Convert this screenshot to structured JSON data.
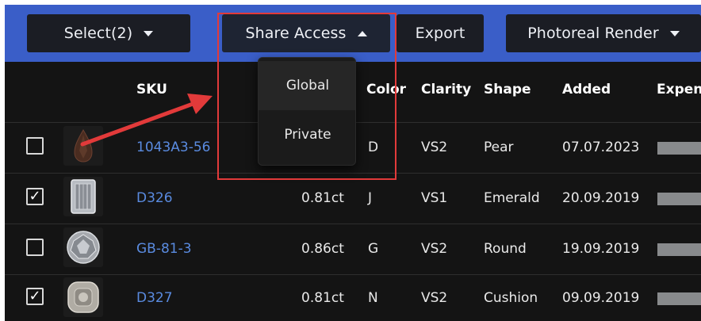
{
  "toolbar": {
    "select_label": "Select(2)",
    "share_label": "Share Access",
    "export_label": "Export",
    "render_label": "Photoreal Render"
  },
  "share_menu": {
    "items": [
      "Global",
      "Private"
    ]
  },
  "table": {
    "headers": {
      "sku": "SKU",
      "color": "Color",
      "clarity": "Clarity",
      "shape": "Shape",
      "added": "Added",
      "expense": "Expen"
    },
    "rows": [
      {
        "checked": false,
        "sku": "1043A3-56",
        "carat": "",
        "color": "D",
        "clarity": "VS2",
        "shape": "Pear",
        "added": "07.07.2023",
        "thumb": "pear-diamond"
      },
      {
        "checked": true,
        "sku": "D326",
        "carat": "0.81ct",
        "color": "J",
        "clarity": "VS1",
        "shape": "Emerald",
        "added": "20.09.2019",
        "thumb": "emerald-diamond"
      },
      {
        "checked": false,
        "sku": "GB-81-3",
        "carat": "0.86ct",
        "color": "G",
        "clarity": "VS2",
        "shape": "Round",
        "added": "19.09.2019",
        "thumb": "round-diamond"
      },
      {
        "checked": true,
        "sku": "D327",
        "carat": "0.81ct",
        "color": "N",
        "clarity": "VS2",
        "shape": "Cushion",
        "added": "09.09.2019",
        "thumb": "cushion-diamond"
      }
    ]
  },
  "colors": {
    "toolbar": "#3a5ec8",
    "sku_link": "#5a8be0",
    "highlight": "#e23a3a",
    "arrow": "#e23a3a"
  }
}
